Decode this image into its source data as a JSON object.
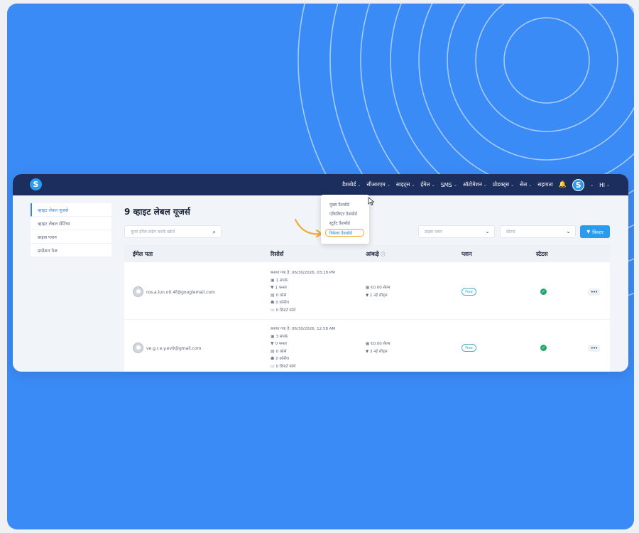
{
  "app": {
    "logo_letter": "S"
  },
  "nav": {
    "items": [
      {
        "label": "डैशबोर्ड",
        "has_chevron": true
      },
      {
        "label": "सीआरएम",
        "has_chevron": true
      },
      {
        "label": "साइट्स",
        "has_chevron": true
      },
      {
        "label": "ईमेल",
        "has_chevron": true
      },
      {
        "label": "SMS",
        "has_chevron": true
      },
      {
        "label": "ऑटोमेशन",
        "has_chevron": true
      },
      {
        "label": "प्रोडक्ट्स",
        "has_chevron": true
      },
      {
        "label": "सेल",
        "has_chevron": true
      },
      {
        "label": "सहायता",
        "has_chevron": false
      }
    ],
    "bell_icon": "bell-icon",
    "avatar_letter": "S",
    "greeting": "HI"
  },
  "dashboard_dropdown": {
    "items": [
      "मुख्य डैशबोर्ड",
      "एफिलिएट डैशबोर्ड",
      "स्टूडेंट डैशबोर्ड",
      "रिसेलर डैशबोर्ड"
    ],
    "highlighted_index": 3,
    "highlight_color": "#f4a93b"
  },
  "sidebar": {
    "items": [
      {
        "label": "व्हाइट लेबल यूजर्स",
        "active": true
      },
      {
        "label": "व्हाइट लेबल सेटिंग्स",
        "active": false
      },
      {
        "label": "प्राइस प्लान",
        "active": false
      },
      {
        "label": "प्रमोशन पेज",
        "active": false
      }
    ]
  },
  "main": {
    "title": "9 व्हाइट लेबल यूजर्स",
    "search_placeholder": "यूजर ईमेल टाईप करके खोजें",
    "plan_select_placeholder": "प्राइस प्लान",
    "status_select_placeholder": "स्टेटस",
    "filter_button": "फ़िल्टर"
  },
  "table": {
    "headers": {
      "email": "ईमेल पता",
      "resources": "रिसोर्स",
      "stats": "आंकड़े",
      "plan": "प्लान",
      "status": "स्टेटस"
    },
    "rows": [
      {
        "email": "ros.a.lun.o0.4f@googlemail.com",
        "created": "बनाया गया है: 06/30/2026, 03:18 PM",
        "resources": [
          "1 संपर्क",
          "1 फनल",
          "0 कोर्स",
          "0 कोर्सेज",
          "0 डिपार्ट फॉर्म"
        ],
        "stats": [
          "€0.00 सेल्स",
          "1 नई लीड्स"
        ],
        "plan": "Free"
      },
      {
        "email": "ve.g.r.e.y.ev9@gmail.com",
        "created": "बनाया गया है: 06/30/2026, 12:58 AM",
        "resources": [
          "3 संपर्क",
          "0 फनल",
          "0 कोर्स",
          "0 कोर्सेज",
          "0 डिपार्ट फॉर्म"
        ],
        "stats": [
          "€0.00 सेल्स",
          "3 नई लीड्स"
        ],
        "plan": "Free"
      }
    ]
  },
  "colors": {
    "background": "#3b8bf6",
    "topbar": "#1c2e5e",
    "accent": "#2a9cf0",
    "status_ok": "#21a86b"
  }
}
